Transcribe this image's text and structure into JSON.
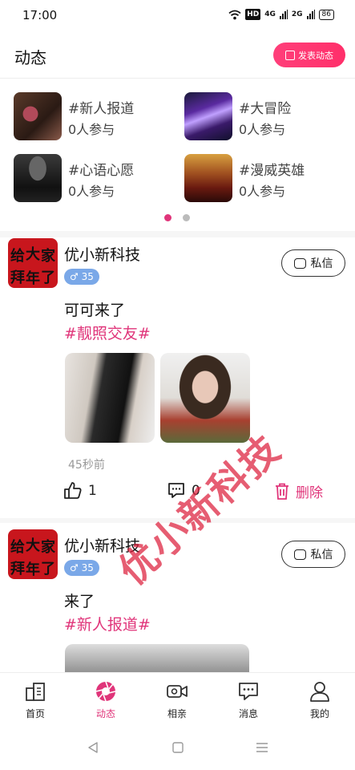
{
  "status_bar": {
    "time": "17:00",
    "network_hd": "HD",
    "signal_1": "4G",
    "signal_2": "2G",
    "battery": "86"
  },
  "header": {
    "title": "动态",
    "post_button_label": "发表动态",
    "post_button_icon": "edit-icon"
  },
  "topics": [
    {
      "name": "#新人报道",
      "count": "0人参与"
    },
    {
      "name": "#大冒险",
      "count": "0人参与"
    },
    {
      "name": "#心语心愿",
      "count": "0人参与"
    },
    {
      "name": "#漫威英雄",
      "count": "0人参与"
    }
  ],
  "carousel": {
    "pages": 2,
    "active": 0,
    "active_color": "#e0357a",
    "inactive_color": "#bbbbbb"
  },
  "posts": [
    {
      "username": "优小新科技",
      "avatar_text": [
        "给",
        "大",
        "家",
        "拜",
        "年",
        "了"
      ],
      "gender_age": "♂ 35",
      "message_label": "私信",
      "content": "可可来了",
      "tag": "#靓照交友#",
      "time_ago": "45秒前",
      "likes": "1",
      "comments": "0",
      "delete_label": "删除"
    },
    {
      "username": "优小新科技",
      "avatar_text": [
        "给",
        "大",
        "家",
        "拜",
        "年",
        "了"
      ],
      "gender_age": "♂ 35",
      "message_label": "私信",
      "content": "来了",
      "tag": "#新人报道#"
    }
  ],
  "watermark": "优小新科技",
  "nav": [
    {
      "label": "首页",
      "icon": "home-icon",
      "active": false
    },
    {
      "label": "动态",
      "icon": "aperture-icon",
      "active": true
    },
    {
      "label": "相亲",
      "icon": "video-camera-icon",
      "active": false
    },
    {
      "label": "消息",
      "icon": "chat-icon",
      "active": false
    },
    {
      "label": "我的",
      "icon": "profile-icon",
      "active": false
    }
  ],
  "colors": {
    "accent": "#e0357a",
    "gender_badge": "#7aa8e8"
  }
}
